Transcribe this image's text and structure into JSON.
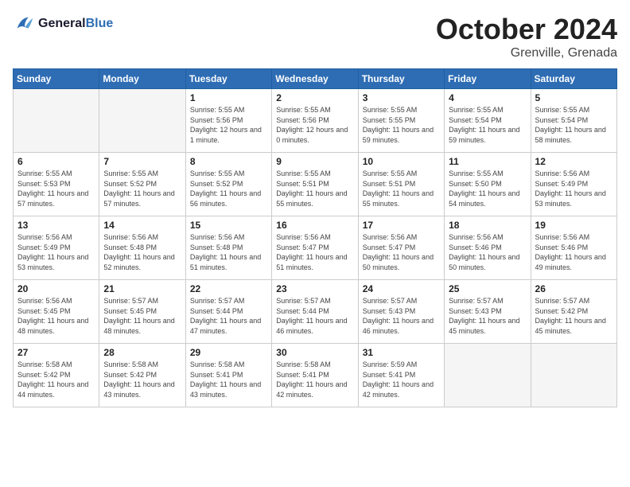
{
  "header": {
    "logo_line1": "General",
    "logo_line2": "Blue",
    "month": "October 2024",
    "location": "Grenville, Grenada"
  },
  "weekdays": [
    "Sunday",
    "Monday",
    "Tuesday",
    "Wednesday",
    "Thursday",
    "Friday",
    "Saturday"
  ],
  "weeks": [
    [
      {
        "day": "",
        "empty": true
      },
      {
        "day": "",
        "empty": true
      },
      {
        "day": "1",
        "sunrise": "5:55 AM",
        "sunset": "5:56 PM",
        "daylight": "12 hours and 1 minute."
      },
      {
        "day": "2",
        "sunrise": "5:55 AM",
        "sunset": "5:56 PM",
        "daylight": "12 hours and 0 minutes."
      },
      {
        "day": "3",
        "sunrise": "5:55 AM",
        "sunset": "5:55 PM",
        "daylight": "11 hours and 59 minutes."
      },
      {
        "day": "4",
        "sunrise": "5:55 AM",
        "sunset": "5:54 PM",
        "daylight": "11 hours and 59 minutes."
      },
      {
        "day": "5",
        "sunrise": "5:55 AM",
        "sunset": "5:54 PM",
        "daylight": "11 hours and 58 minutes."
      }
    ],
    [
      {
        "day": "6",
        "sunrise": "5:55 AM",
        "sunset": "5:53 PM",
        "daylight": "11 hours and 57 minutes."
      },
      {
        "day": "7",
        "sunrise": "5:55 AM",
        "sunset": "5:52 PM",
        "daylight": "11 hours and 57 minutes."
      },
      {
        "day": "8",
        "sunrise": "5:55 AM",
        "sunset": "5:52 PM",
        "daylight": "11 hours and 56 minutes."
      },
      {
        "day": "9",
        "sunrise": "5:55 AM",
        "sunset": "5:51 PM",
        "daylight": "11 hours and 55 minutes."
      },
      {
        "day": "10",
        "sunrise": "5:55 AM",
        "sunset": "5:51 PM",
        "daylight": "11 hours and 55 minutes."
      },
      {
        "day": "11",
        "sunrise": "5:55 AM",
        "sunset": "5:50 PM",
        "daylight": "11 hours and 54 minutes."
      },
      {
        "day": "12",
        "sunrise": "5:56 AM",
        "sunset": "5:49 PM",
        "daylight": "11 hours and 53 minutes."
      }
    ],
    [
      {
        "day": "13",
        "sunrise": "5:56 AM",
        "sunset": "5:49 PM",
        "daylight": "11 hours and 53 minutes."
      },
      {
        "day": "14",
        "sunrise": "5:56 AM",
        "sunset": "5:48 PM",
        "daylight": "11 hours and 52 minutes."
      },
      {
        "day": "15",
        "sunrise": "5:56 AM",
        "sunset": "5:48 PM",
        "daylight": "11 hours and 51 minutes."
      },
      {
        "day": "16",
        "sunrise": "5:56 AM",
        "sunset": "5:47 PM",
        "daylight": "11 hours and 51 minutes."
      },
      {
        "day": "17",
        "sunrise": "5:56 AM",
        "sunset": "5:47 PM",
        "daylight": "11 hours and 50 minutes."
      },
      {
        "day": "18",
        "sunrise": "5:56 AM",
        "sunset": "5:46 PM",
        "daylight": "11 hours and 50 minutes."
      },
      {
        "day": "19",
        "sunrise": "5:56 AM",
        "sunset": "5:46 PM",
        "daylight": "11 hours and 49 minutes."
      }
    ],
    [
      {
        "day": "20",
        "sunrise": "5:56 AM",
        "sunset": "5:45 PM",
        "daylight": "11 hours and 48 minutes."
      },
      {
        "day": "21",
        "sunrise": "5:57 AM",
        "sunset": "5:45 PM",
        "daylight": "11 hours and 48 minutes."
      },
      {
        "day": "22",
        "sunrise": "5:57 AM",
        "sunset": "5:44 PM",
        "daylight": "11 hours and 47 minutes."
      },
      {
        "day": "23",
        "sunrise": "5:57 AM",
        "sunset": "5:44 PM",
        "daylight": "11 hours and 46 minutes."
      },
      {
        "day": "24",
        "sunrise": "5:57 AM",
        "sunset": "5:43 PM",
        "daylight": "11 hours and 46 minutes."
      },
      {
        "day": "25",
        "sunrise": "5:57 AM",
        "sunset": "5:43 PM",
        "daylight": "11 hours and 45 minutes."
      },
      {
        "day": "26",
        "sunrise": "5:57 AM",
        "sunset": "5:42 PM",
        "daylight": "11 hours and 45 minutes."
      }
    ],
    [
      {
        "day": "27",
        "sunrise": "5:58 AM",
        "sunset": "5:42 PM",
        "daylight": "11 hours and 44 minutes."
      },
      {
        "day": "28",
        "sunrise": "5:58 AM",
        "sunset": "5:42 PM",
        "daylight": "11 hours and 43 minutes."
      },
      {
        "day": "29",
        "sunrise": "5:58 AM",
        "sunset": "5:41 PM",
        "daylight": "11 hours and 43 minutes."
      },
      {
        "day": "30",
        "sunrise": "5:58 AM",
        "sunset": "5:41 PM",
        "daylight": "11 hours and 42 minutes."
      },
      {
        "day": "31",
        "sunrise": "5:59 AM",
        "sunset": "5:41 PM",
        "daylight": "11 hours and 42 minutes."
      },
      {
        "day": "",
        "empty": true
      },
      {
        "day": "",
        "empty": true
      }
    ]
  ]
}
